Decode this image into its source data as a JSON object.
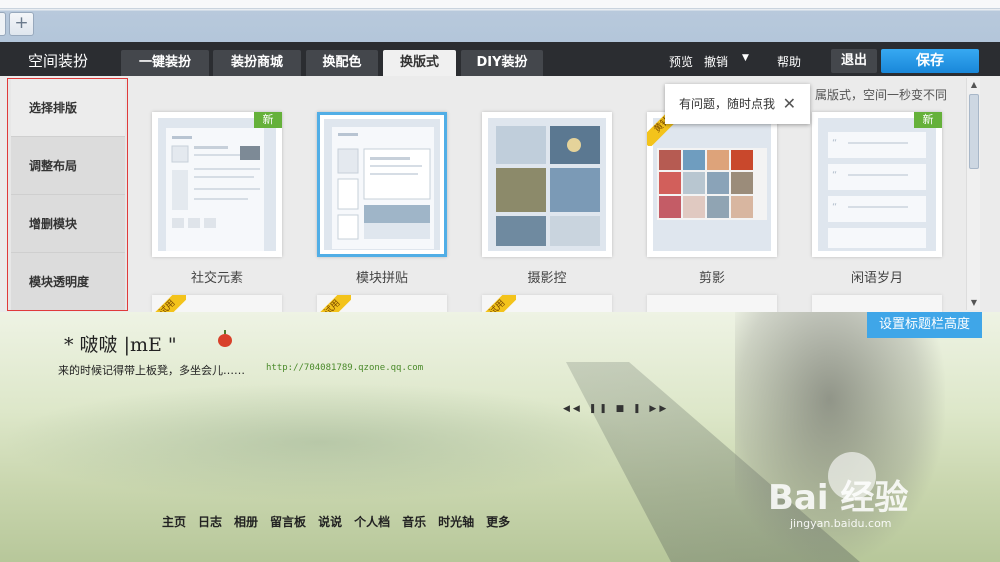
{
  "browser": {
    "new_tab": "+"
  },
  "toolbar": {
    "brand": "空间装扮",
    "tabs": [
      "一键装扮",
      "装扮商城",
      "换配色",
      "换版式",
      "DIY装扮"
    ],
    "links": [
      "预览",
      "撤销",
      "帮助"
    ],
    "exit": "退出",
    "save": "保存"
  },
  "sidebar": {
    "items": [
      "选择排版",
      "调整布局",
      "增删模块",
      "模块透明度"
    ]
  },
  "layouts": [
    {
      "label": "社交元素",
      "badge": "新"
    },
    {
      "label": "模块拼贴",
      "badge": ""
    },
    {
      "label": "摄影控",
      "badge": ""
    },
    {
      "label": "剪影",
      "badge": "黄钻"
    },
    {
      "label": "闲语岁月",
      "badge": "新"
    }
  ],
  "next_row_badge": "试用",
  "tooltip": {
    "text": "有问题，随时点我",
    "close": "✕",
    "trailing": "属版式，空间一秒变不同"
  },
  "skin": {
    "set_title_button": "设置标题栏高度",
    "title": "* 啵啵  |mE \"",
    "subtitle": "来的时候记得带上板凳，多坐会儿……",
    "url": "http://704081789.qzone.qq.com",
    "player": "◀◀ ❚❚ ■ ❚ ▶▶",
    "nav": [
      "主页",
      "日志",
      "相册",
      "留言板",
      "说说",
      "个人档",
      "音乐",
      "时光轴",
      "更多"
    ],
    "watermark": "Bai 经验",
    "watermark_url": "jingyan.baidu.com"
  },
  "colors": {
    "accent": "#1987d9",
    "selected_border": "#51aee6",
    "sidebar_outline": "#e03a3a",
    "new_badge": "#65b13a"
  }
}
